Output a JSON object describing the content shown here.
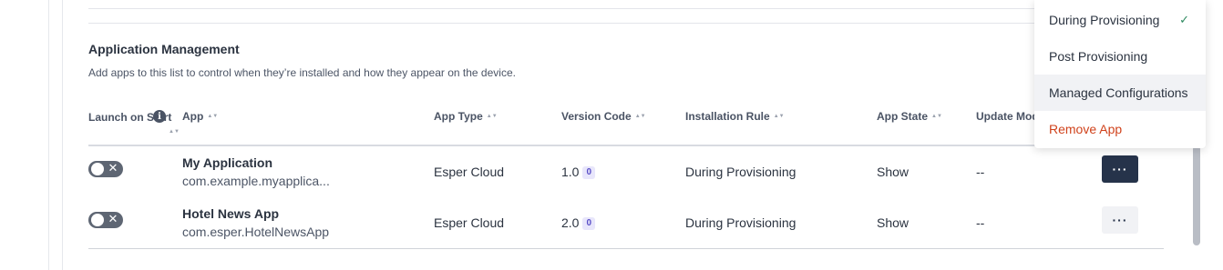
{
  "section": {
    "title": "Application Management",
    "description": "Add apps to this list to control when they’re installed and how they appear on the device."
  },
  "columns": {
    "launch_on_start": "Launch on Start",
    "app": "App",
    "app_type": "App Type",
    "version_code": "Version Code",
    "installation_rule": "Installation Rule",
    "app_state": "App State",
    "update_mode": "Update Mod"
  },
  "rows": [
    {
      "launch_on_start": false,
      "name": "My Application",
      "package": "com.example.myapplica...",
      "app_type": "Esper Cloud",
      "version": "1.0",
      "version_badge": "0",
      "installation_rule": "During Provisioning",
      "app_state": "Show",
      "update_mode": "--",
      "menu_open": true
    },
    {
      "launch_on_start": false,
      "name": "Hotel News App",
      "package": "com.esper.HotelNewsApp",
      "app_type": "Esper Cloud",
      "version": "2.0",
      "version_badge": "0",
      "installation_rule": "During Provisioning",
      "app_state": "Show",
      "update_mode": "--",
      "menu_open": false
    }
  ],
  "more_button_label": "···",
  "info_icon_glyph": "i",
  "toggle_glyph": "✕",
  "dropdown_menu": {
    "items": [
      {
        "label": "During Provisioning",
        "checked": true,
        "check_glyph": "✓"
      },
      {
        "label": "Post Provisioning"
      },
      {
        "label": "Managed Configurations",
        "hovered": true
      },
      {
        "label": "Remove App",
        "danger": true
      }
    ]
  },
  "colors": {
    "primary_button": "#26334a",
    "danger": "#d0421b",
    "check": "#2f8a60",
    "badge_bg": "#e8e6fb",
    "badge_text": "#5a4fc7"
  }
}
